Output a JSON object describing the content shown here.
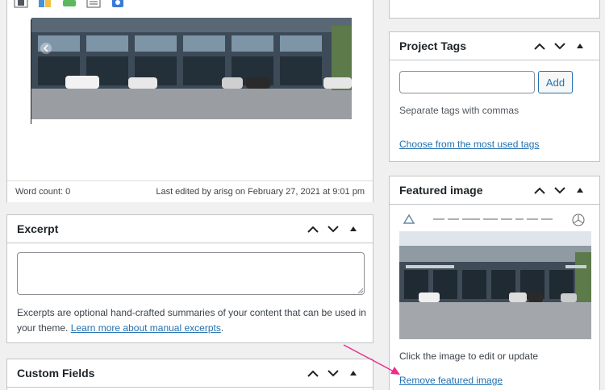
{
  "editor": {
    "word_count": "Word count: 0",
    "last_edited": "Last edited by arisg on February 27, 2021 at 9:01 pm"
  },
  "excerpt": {
    "title": "Excerpt",
    "textarea_value": "",
    "description": "Excerpts are optional hand-crafted summaries of your content that can be used in your theme.",
    "learn_more_link": "Learn more about manual excerpts",
    "period": "."
  },
  "custom_fields": {
    "title": "Custom Fields"
  },
  "project_tags": {
    "title": "Project Tags",
    "input_value": "",
    "add_label": "Add",
    "hint": "Separate tags with commas",
    "choose_link": "Choose from the most used tags"
  },
  "featured_image": {
    "title": "Featured image",
    "hint": "Click the image to edit or update",
    "remove_link": "Remove featured image"
  },
  "colors": {
    "link": "#2271b1",
    "annotation_arrow": "#e8308c"
  },
  "icons": [
    "chevron-up-icon",
    "chevron-down-icon",
    "triangle-up-icon"
  ]
}
